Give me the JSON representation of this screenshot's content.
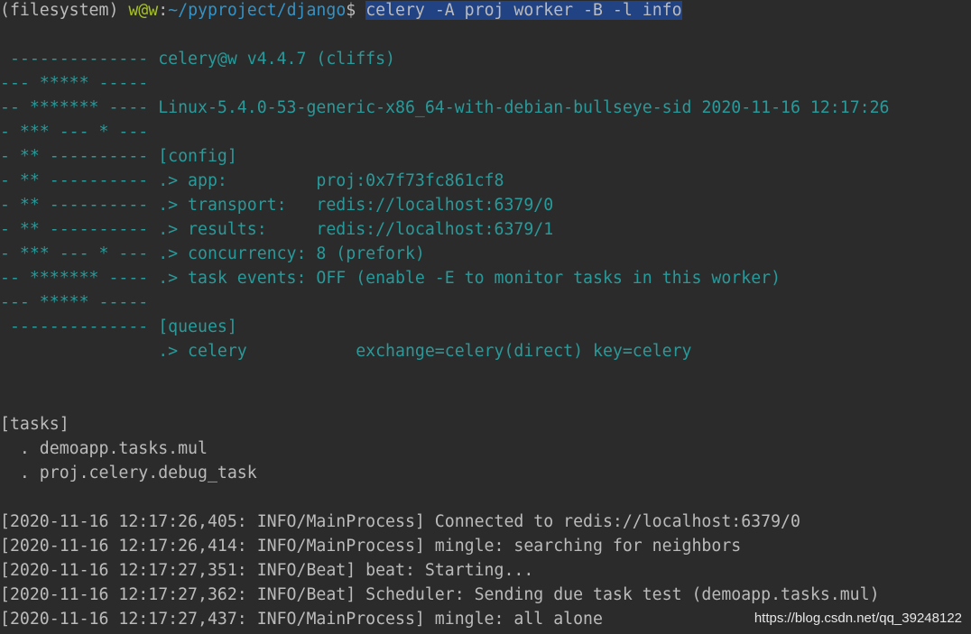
{
  "prompt": {
    "env": "(filesystem) ",
    "userhost": "w@w",
    "colon": ":",
    "path": "~/pyproject/django",
    "dollar": "$ ",
    "command": "celery -A proj worker -B -l info"
  },
  "banner": [
    {
      "art": " -------------- ",
      "text": "celery@w v4.4.7 (cliffs)"
    },
    {
      "art": "--- ***** ----- ",
      "text": ""
    },
    {
      "art": "-- ******* ---- ",
      "text": "Linux-5.4.0-53-generic-x86_64-with-debian-bullseye-sid 2020-11-16 12:17:26"
    },
    {
      "art": "- *** --- * --- ",
      "text": ""
    },
    {
      "art": "- ** ---------- ",
      "text": "[config]"
    },
    {
      "art": "- ** ---------- ",
      "text": ".> app:         proj:0x7f73fc861cf8"
    },
    {
      "art": "- ** ---------- ",
      "text": ".> transport:   redis://localhost:6379/0"
    },
    {
      "art": "- ** ---------- ",
      "text": ".> results:     redis://localhost:6379/1"
    },
    {
      "art": "- *** --- * --- ",
      "text": ".> concurrency: 8 (prefork)"
    },
    {
      "art": "-- ******* ---- ",
      "text": ".> task events: OFF (enable -E to monitor tasks in this worker)"
    },
    {
      "art": "--- ***** ----- ",
      "text": ""
    },
    {
      "art": " -------------- ",
      "text": "[queues]"
    },
    {
      "art": "                ",
      "text": ".> celery           exchange=celery(direct) key=celery"
    }
  ],
  "tasks": {
    "header": "[tasks]",
    "items": [
      "  . demoapp.tasks.mul",
      "  . proj.celery.debug_task"
    ]
  },
  "logs": [
    "[2020-11-16 12:17:26,405: INFO/MainProcess] Connected to redis://localhost:6379/0",
    "[2020-11-16 12:17:26,414: INFO/MainProcess] mingle: searching for neighbors",
    "[2020-11-16 12:17:27,351: INFO/Beat] beat: Starting...",
    "[2020-11-16 12:17:27,362: INFO/Beat] Scheduler: Sending due task test (demoapp.tasks.mul)",
    "[2020-11-16 12:17:27,437: INFO/MainProcess] mingle: all alone"
  ],
  "watermark": "https://blog.csdn.net/qq_39248122",
  "colors": {
    "background": "#2b2b2b",
    "foreground": "#bbbbbb",
    "banner": "#299999",
    "userhost": "#a8c023",
    "path": "#3592c4",
    "selection": "#214283"
  }
}
